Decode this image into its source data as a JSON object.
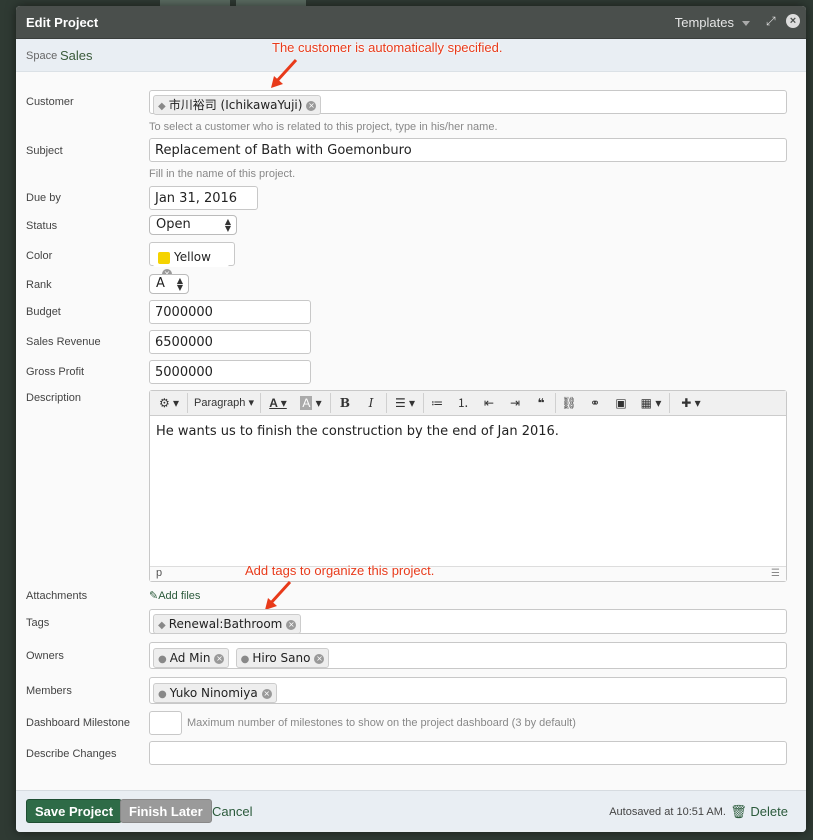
{
  "modal": {
    "title": "Edit Project",
    "templates_label": "Templates",
    "space_label": "Space",
    "space_value": "Sales"
  },
  "annotations": {
    "customer": "The customer is automatically specified.",
    "tags": "Add tags to organize this project."
  },
  "fields": {
    "customer": {
      "label": "Customer",
      "chip": "市川裕司 (IchikawaYuji)",
      "hint": "To select a customer who is related to this project, type in his/her name."
    },
    "subject": {
      "label": "Subject",
      "value": "Replacement of Bath with Goemonburo",
      "hint": "Fill in the name of this project."
    },
    "due_by": {
      "label": "Due by",
      "value": "Jan 31, 2016"
    },
    "status": {
      "label": "Status",
      "value": "Open"
    },
    "color": {
      "label": "Color",
      "value": "Yellow",
      "swatch": "#f5d300"
    },
    "rank": {
      "label": "Rank",
      "value": "A"
    },
    "budget": {
      "label": "Budget",
      "value": "7000000"
    },
    "sales_revenue": {
      "label": "Sales Revenue",
      "value": "6500000"
    },
    "gross_profit": {
      "label": "Gross Profit",
      "value": "5000000"
    },
    "description": {
      "label": "Description",
      "content": "He wants us to finish the construction by the end of Jan 2016.",
      "format_label": "Paragraph",
      "status_path": "p"
    },
    "attachments": {
      "label": "Attachments",
      "add_files": "Add files"
    },
    "tags": {
      "label": "Tags",
      "chips": [
        "Renewal:Bathroom"
      ]
    },
    "owners": {
      "label": "Owners",
      "chips": [
        "Ad Min",
        "Hiro Sano"
      ]
    },
    "members": {
      "label": "Members",
      "chips": [
        "Yuko Ninomiya"
      ]
    },
    "dashboard_milestone": {
      "label": "Dashboard Milestone",
      "value": "",
      "hint": "Maximum number of milestones to show on the project dashboard (3 by default)"
    },
    "describe_changes": {
      "label": "Describe Changes",
      "value": ""
    }
  },
  "footer": {
    "save": "Save Project",
    "finish_later": "Finish Later",
    "cancel": "Cancel",
    "autosaved": "Autosaved at 10:51 AM.",
    "delete": "Delete"
  }
}
